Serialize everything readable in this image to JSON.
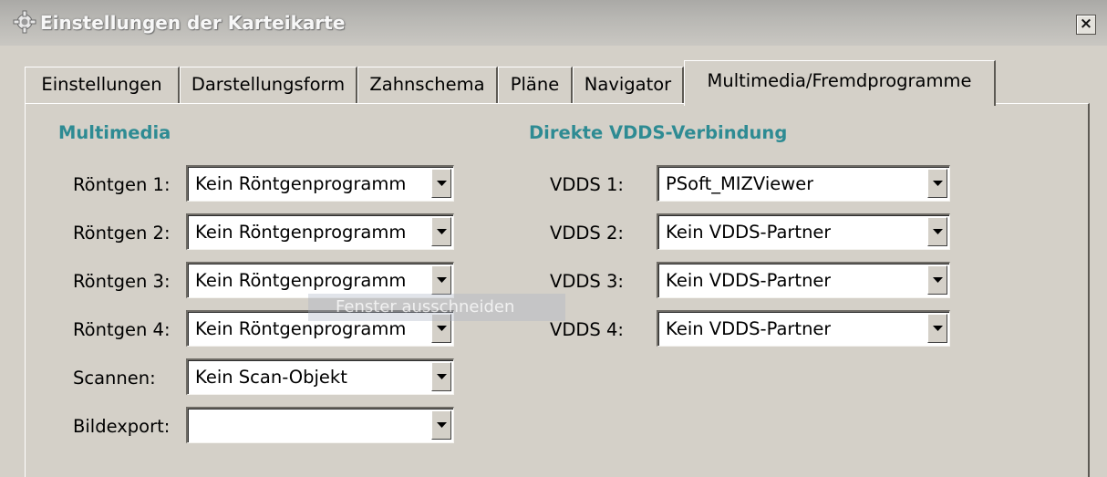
{
  "window": {
    "title": "Einstellungen der Karteikarte",
    "icon": "gear-icon",
    "close_label": "×"
  },
  "tabs": [
    {
      "label": "Einstellungen",
      "active": false
    },
    {
      "label": "Darstellungsform",
      "active": false
    },
    {
      "label": "Zahnschema",
      "active": false
    },
    {
      "label": "Pläne",
      "active": false
    },
    {
      "label": "Navigator",
      "active": false
    },
    {
      "label": "Multimedia/Fremdprogramme",
      "active": true
    }
  ],
  "multimedia": {
    "heading": "Multimedia",
    "rows": [
      {
        "label": "Röntgen 1:",
        "value": "Kein Röntgenprogramm"
      },
      {
        "label": "Röntgen 2:",
        "value": "Kein Röntgenprogramm"
      },
      {
        "label": "Röntgen 3:",
        "value": "Kein Röntgenprogramm"
      },
      {
        "label": "Röntgen 4:",
        "value": "Kein Röntgenprogramm"
      },
      {
        "label": "Scannen:",
        "value": "Kein Scan-Objekt"
      },
      {
        "label": "Bildexport:",
        "value": ""
      }
    ]
  },
  "vdds": {
    "heading": "Direkte VDDS-Verbindung",
    "rows": [
      {
        "label": "VDDS 1:",
        "value": "PSoft_MIZViewer"
      },
      {
        "label": "VDDS 2:",
        "value": "Kein VDDS-Partner"
      },
      {
        "label": "VDDS 3:",
        "value": "Kein VDDS-Partner"
      },
      {
        "label": "VDDS 4:",
        "value": "Kein VDDS-Partner"
      }
    ]
  },
  "overlay": {
    "text": "Fenster ausschneiden"
  },
  "colors": {
    "accent": "#2e8b93",
    "face": "#d4d0c8"
  }
}
